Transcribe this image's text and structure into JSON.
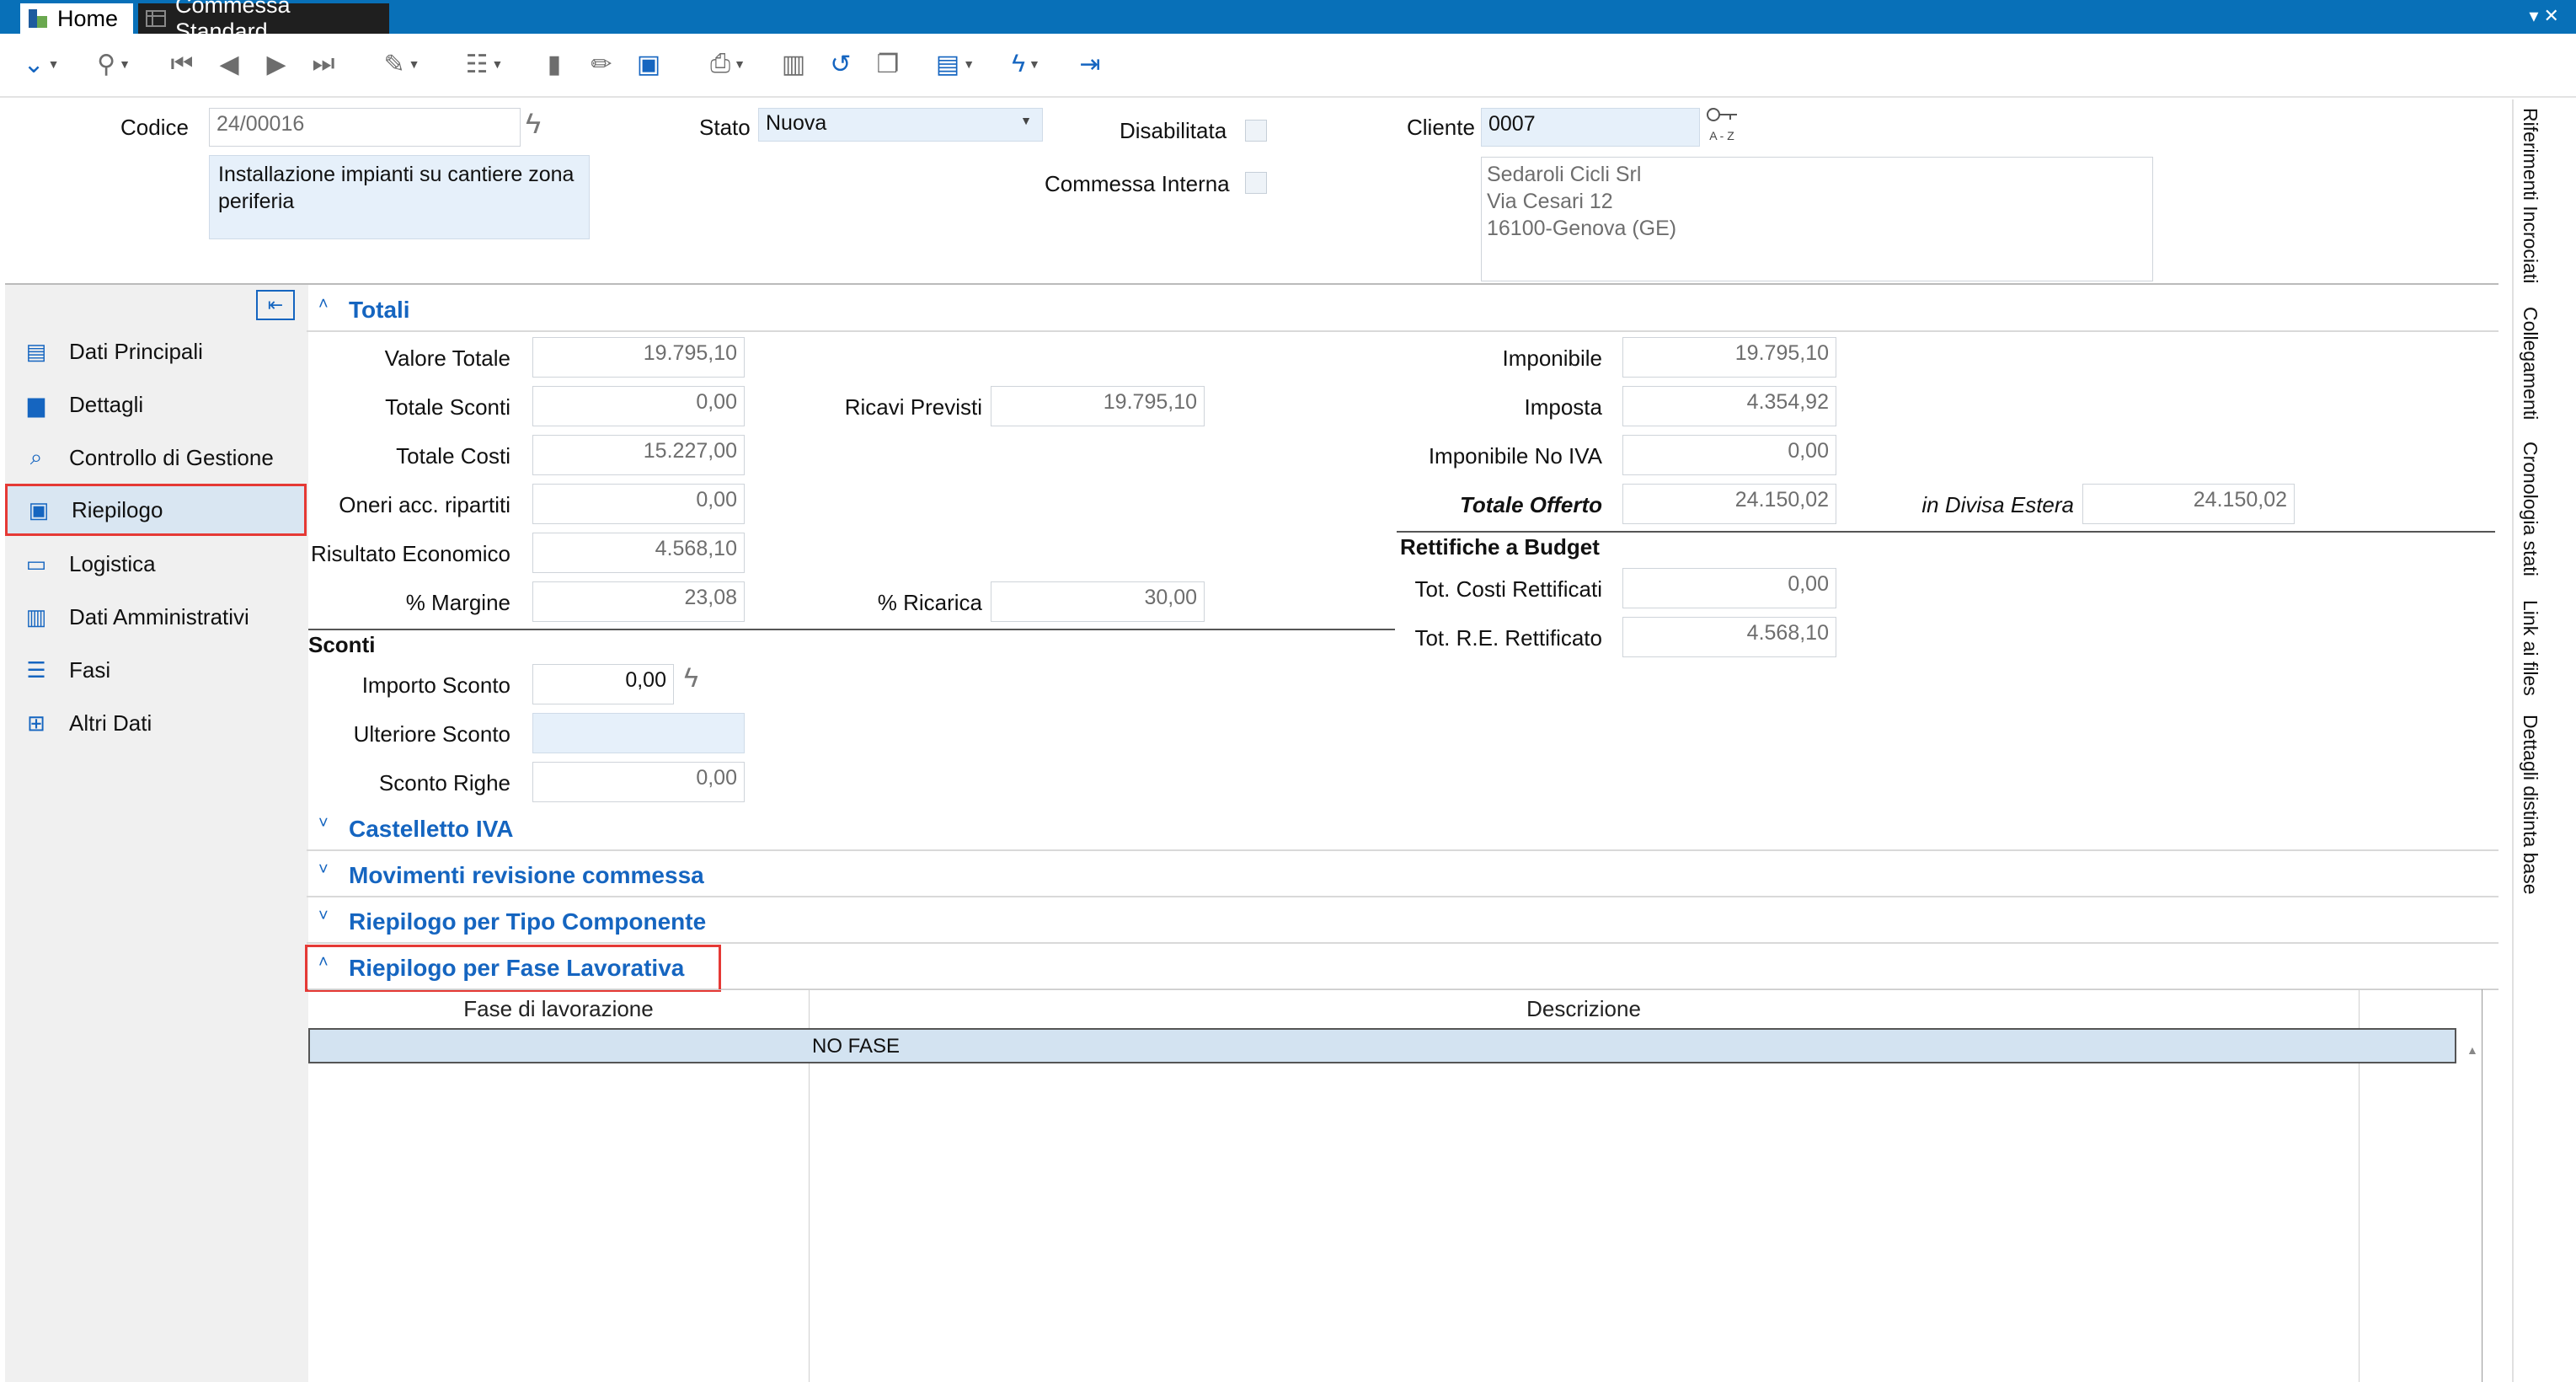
{
  "titlebar": {
    "tab_home": "Home",
    "tab_doc": "Commessa Standard"
  },
  "toolbar": {
    "icons": [
      "expand-icon",
      "search-icon",
      "first-icon",
      "prev-icon",
      "next-icon",
      "last-icon",
      "paint-icon",
      "database-icon",
      "new-document-icon",
      "edit-icon",
      "save-icon",
      "print-icon",
      "delete-icon",
      "undo-icon",
      "copy-icon",
      "report-icon",
      "lightning-icon",
      "exit-icon"
    ]
  },
  "header": {
    "codice_label": "Codice",
    "codice_value": "24/00016",
    "descrizione": "Installazione impianti su cantiere zona periferia",
    "stato_label": "Stato",
    "stato_value": "Nuova",
    "disabilitata_label": "Disabilitata",
    "interna_label": "Commessa Interna",
    "cliente_label": "Cliente",
    "cliente_value": "0007",
    "az_label": "A - Z",
    "cliente_nome": "Sedaroli Cicli Srl",
    "cliente_via": "Via Cesari 12",
    "cliente_citta": "16100-Genova (GE)"
  },
  "sidebar": {
    "items": [
      "Dati Principali",
      "Dettagli",
      "Controllo di Gestione",
      "Riepilogo",
      "Logistica",
      "Dati Amministrativi",
      "Fasi",
      "Altri Dati"
    ],
    "selected": "Riepilogo"
  },
  "totali": {
    "title": "Totali",
    "valore_totale_label": "Valore Totale",
    "valore_totale": "19.795,10",
    "totale_sconti_label": "Totale Sconti",
    "totale_sconti": "0,00",
    "totale_costi_label": "Totale Costi",
    "totale_costi": "15.227,00",
    "oneri_label": "Oneri acc. ripartiti",
    "oneri": "0,00",
    "risultato_label": "Risultato Economico",
    "risultato": "4.568,10",
    "margine_label": "% Margine",
    "margine": "23,08",
    "ricavi_label": "Ricavi Previsti",
    "ricavi": "19.795,10",
    "ricarica_label": "% Ricarica",
    "ricarica": "30,00",
    "imponibile_label": "Imponibile",
    "imponibile": "19.795,10",
    "imposta_label": "Imposta",
    "imposta": "4.354,92",
    "imponibile_noiva_label": "Imponibile No IVA",
    "imponibile_noiva": "0,00",
    "totale_offerto_label": "Totale Offerto",
    "totale_offerto": "24.150,02",
    "divisa_label": "in Divisa Estera",
    "divisa": "24.150,02",
    "rettifiche_title": "Rettifiche a Budget",
    "costi_rett_label": "Tot. Costi Rettificati",
    "costi_rett": "0,00",
    "re_rett_label": "Tot. R.E. Rettificato",
    "re_rett": "4.568,10",
    "sconti_title": "Sconti",
    "importo_sconto_label": "Importo Sconto",
    "importo_sconto": "0,00",
    "ulteriore_sconto_label": "Ulteriore Sconto",
    "ulteriore_sconto": "",
    "sconto_righe_label": "Sconto Righe",
    "sconto_righe": "0,00"
  },
  "sections": {
    "castelletto": "Castelletto IVA",
    "movimenti": "Movimenti revisione commessa",
    "tipo_componente": "Riepilogo per Tipo Componente",
    "fase": "Riepilogo per Fase Lavorativa"
  },
  "grid": {
    "col_fase": "Fase di lavorazione",
    "col_descrizione": "Descrizione",
    "rows": [
      {
        "fase": "",
        "descrizione": "NO FASE"
      }
    ]
  },
  "right_tabs": [
    "Riferimenti Incrociati",
    "Collegamenti",
    "Cronologia stati",
    "Link ai files",
    "Dettagli distinta base"
  ]
}
